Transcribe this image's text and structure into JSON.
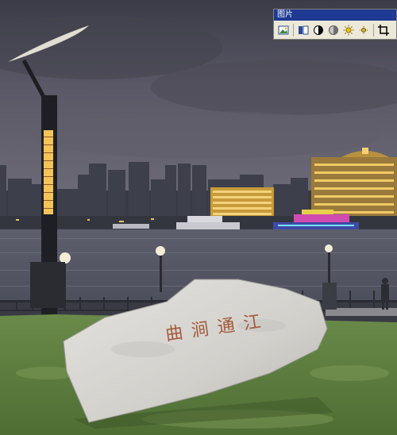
{
  "toolbar": {
    "title": "图片",
    "buttons": [
      {
        "name": "insert-picture",
        "icon": "insert-picture-icon"
      },
      {
        "name": "color",
        "icon": "color-icon"
      },
      {
        "name": "more-contrast",
        "icon": "more-contrast-icon"
      },
      {
        "name": "less-contrast",
        "icon": "less-contrast-icon"
      },
      {
        "name": "more-brightness",
        "icon": "more-brightness-icon"
      },
      {
        "name": "less-brightness",
        "icon": "less-brightness-icon"
      },
      {
        "name": "crop",
        "icon": "crop-icon"
      }
    ]
  },
  "stone": {
    "inscription": "曲 涧 通 江"
  },
  "colors": {
    "sky": "#4a4a58",
    "river": "#5e5f6e",
    "grass": "#5a7a3c",
    "stone": "#d8d6d2",
    "inscription": "#a35a3e",
    "toolbar_title_bg": "#1f3a93"
  }
}
